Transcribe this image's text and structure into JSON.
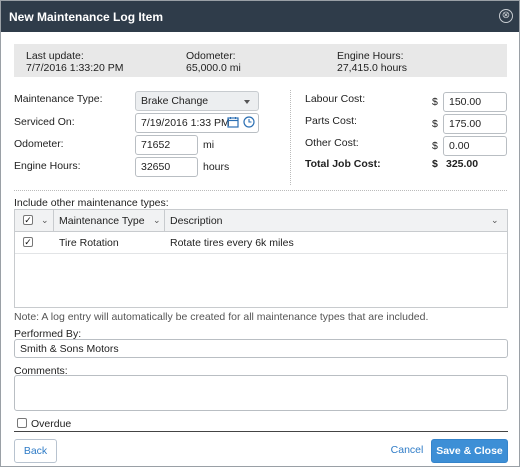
{
  "dialog": {
    "title": "New Maintenance Log Item",
    "close_glyph": "⊗"
  },
  "info": {
    "last_update_label": "Last update:",
    "last_update_value": "7/7/2016 1:33:20 PM",
    "odometer_label": "Odometer:",
    "odometer_value": "65,000.0 mi",
    "engine_hours_label": "Engine Hours:",
    "engine_hours_value": "27,415.0 hours"
  },
  "form": {
    "maintenance_type_label": "Maintenance Type:",
    "maintenance_type_value": "Brake Change",
    "serviced_on_label": "Serviced On:",
    "serviced_on_value": "7/19/2016 1:33 PM",
    "odometer_label": "Odometer:",
    "odometer_value": "71652",
    "odometer_unit": "mi",
    "engine_hours_label": "Engine Hours:",
    "engine_hours_value": "32650",
    "engine_hours_unit": "hours"
  },
  "costs": {
    "currency": "$",
    "labour_label": "Labour Cost:",
    "labour_value": "150.00",
    "parts_label": "Parts Cost:",
    "parts_value": "175.00",
    "other_label": "Other Cost:",
    "other_value": "0.00",
    "total_label": "Total Job Cost:",
    "total_value": "325.00"
  },
  "other_types": {
    "heading": "Include other maintenance types:",
    "columns": {
      "type": "Maintenance Type",
      "description": "Description"
    },
    "rows": [
      {
        "checked": true,
        "type": "Tire Rotation",
        "description": "Rotate tires every 6k miles"
      }
    ],
    "note": "Note: A log entry will automatically be created for all maintenance types that are included."
  },
  "performed_by": {
    "label": "Performed By:",
    "value": "Smith & Sons Motors"
  },
  "comments": {
    "label": "Comments:"
  },
  "overdue": {
    "label": "Overdue",
    "checked": false
  },
  "buttons": {
    "back": "Back",
    "cancel": "Cancel",
    "save": "Save & Close"
  },
  "colors": {
    "titlebar": "#2f3c4a",
    "accent": "#3d8fd6",
    "link": "#2f7cc7"
  },
  "icons": {
    "calendar": "calendar-icon",
    "clock": "clock-icon",
    "close": "close-icon",
    "check": "check-icon"
  }
}
